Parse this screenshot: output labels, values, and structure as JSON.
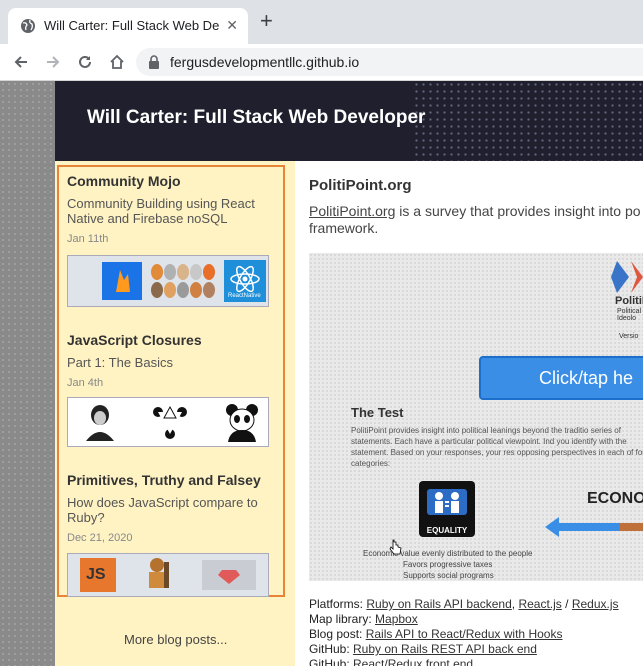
{
  "browser": {
    "tab_title": "Will Carter: Full Stack Web De",
    "new_tab": "+",
    "close": "✕",
    "url": "fergusdevelopmentllc.github.io"
  },
  "site": {
    "title": "Will Carter: Full Stack Web Developer"
  },
  "sidebar": {
    "posts": [
      {
        "title": "Community Mojo",
        "subtitle": "Community Building using React Native and Firebase noSQL",
        "date": "Jan 11th"
      },
      {
        "title": "JavaScript Closures",
        "subtitle": "Part 1: The Basics",
        "date": "Jan 4th"
      },
      {
        "title": "Primitives, Truthy and Falsey",
        "subtitle": "How does JavaScript compare to Ruby?",
        "date": "Dec 21, 2020"
      }
    ],
    "thumbs": {
      "js": "JS",
      "react": "ReactNative"
    },
    "more_posts": "More blog posts..."
  },
  "main": {
    "title": "PolitiPoint.org",
    "intro_link": "PolitiPoint.org",
    "intro_text": " is a survey that provides insight into po",
    "intro_line2": "framework.",
    "shot": {
      "brand": "PolitiPoin",
      "brand_sub": "Political Ideolo",
      "version": "Versio",
      "button": "Click/tap he",
      "test_title": "The Test",
      "test_body": "PolitiPoint provides insight into political leanings beyond the traditio series of statements. Each have a particular political viewpoint. Ind you identify with the statement. Based on your responses, your res opposing perspectives in each of four categories:",
      "equality": "EQUALITY",
      "econ": "ECONO",
      "cap1": "Economic value evenly distributed to the people",
      "cap2": "Favors progressive taxes",
      "cap3": "Supports social programs"
    },
    "links": {
      "platforms_label": "Platforms: ",
      "platforms_1": "Ruby on Rails API backend",
      "platforms_sep1": ", ",
      "platforms_2": "React.js",
      "platforms_sep2": " / ",
      "platforms_3": "Redux.js",
      "map_label": "Map library: ",
      "map_link": "Mapbox",
      "blog_label": "Blog post: ",
      "blog_link": "Rails API to React/Redux with Hooks",
      "github_label": "GitHub: ",
      "github_link": "Ruby on Rails REST API back end",
      "github2_label": "GitHub: ",
      "github2_link": "React/Redux front end"
    }
  },
  "colors": {
    "header_bg": "#1f1f2e",
    "sidebar_bg": "#fff3c4",
    "accent_border": "#e8843a"
  }
}
